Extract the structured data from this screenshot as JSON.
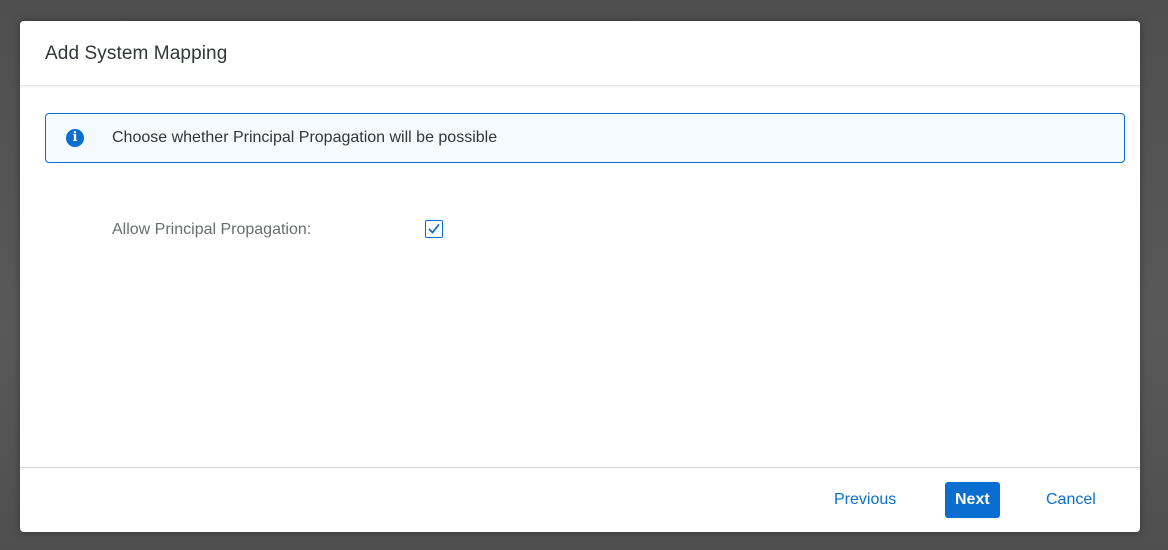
{
  "dialog": {
    "title": "Add System Mapping"
  },
  "info": {
    "icon": "info-icon",
    "message": "Choose whether Principal Propagation will be possible"
  },
  "form": {
    "allow_principal_propagation_label": "Allow Principal Propagation:",
    "allow_principal_propagation_checked": true
  },
  "footer": {
    "previous_label": "Previous",
    "next_label": "Next",
    "cancel_label": "Cancel"
  },
  "colors": {
    "accent": "#0a6ed1",
    "title_text": "#32363a",
    "label_text": "#6a6d70",
    "info_background": "#f5faff",
    "overlay": "#5a5a5a"
  }
}
